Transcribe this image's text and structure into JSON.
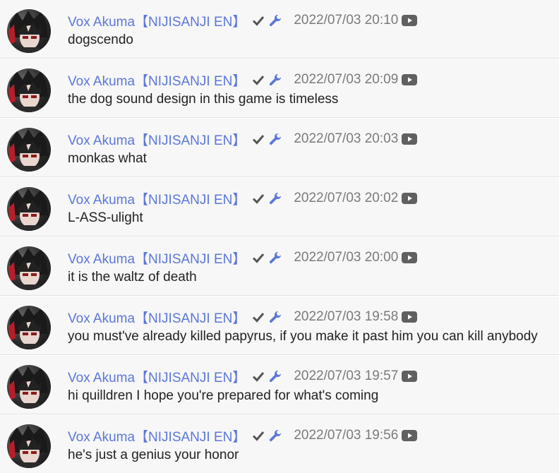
{
  "colors": {
    "author": "#5b77d9",
    "timestamp": "#7a7a7a",
    "message": "#222222",
    "row_bg": "#f7f7f7",
    "mod_icon": "#5b77d9",
    "verified_icon": "#555555"
  },
  "messages": [
    {
      "author": "Vox Akuma【NIJISANJI EN】",
      "time": "2022/07/03 20:10",
      "text": "dogscendo"
    },
    {
      "author": "Vox Akuma【NIJISANJI EN】",
      "time": "2022/07/03 20:09",
      "text": "the dog sound design in this game is timeless"
    },
    {
      "author": "Vox Akuma【NIJISANJI EN】",
      "time": "2022/07/03 20:03",
      "text": "monkas what"
    },
    {
      "author": "Vox Akuma【NIJISANJI EN】",
      "time": "2022/07/03 20:02",
      "text": "L-ASS-ulight"
    },
    {
      "author": "Vox Akuma【NIJISANJI EN】",
      "time": "2022/07/03 20:00",
      "text": "it is the waltz of death"
    },
    {
      "author": "Vox Akuma【NIJISANJI EN】",
      "time": "2022/07/03 19:58",
      "text": "you must've already killed papyrus, if you make it past him you can kill anybody"
    },
    {
      "author": "Vox Akuma【NIJISANJI EN】",
      "time": "2022/07/03 19:57",
      "text": "hi quilldren I hope you're prepared for what's coming"
    },
    {
      "author": "Vox Akuma【NIJISANJI EN】",
      "time": "2022/07/03 19:56",
      "text": "he's just a genius your honor"
    }
  ],
  "icons": {
    "avatar": "avatar",
    "verified": "check-icon",
    "moderator": "wrench-icon",
    "source": "youtube-icon"
  }
}
